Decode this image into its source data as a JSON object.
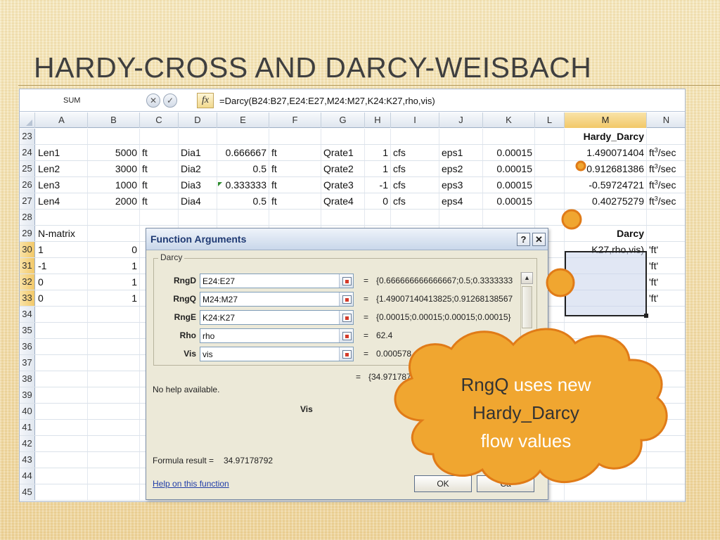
{
  "slide": {
    "title": "HARDY-CROSS AND DARCY-WEISBACH"
  },
  "formula_bar": {
    "name_box": "SUM",
    "cancel_icon": "✕",
    "enter_icon": "✓",
    "fx_label": "fx",
    "formula": "=Darcy(B24:B27,E24:E27,M24:M27,K24:K27,rho,vis)"
  },
  "columns": [
    "A",
    "B",
    "C",
    "D",
    "E",
    "F",
    "G",
    "H",
    "I",
    "J",
    "K",
    "L",
    "M",
    "N"
  ],
  "sheet": {
    "row_numbers": [
      "23",
      "24",
      "25",
      "26",
      "27",
      "28",
      "29",
      "30",
      "31",
      "32",
      "33",
      "34",
      "35",
      "36",
      "37",
      "38",
      "39",
      "40",
      "41",
      "42",
      "43",
      "44",
      "45"
    ],
    "cells": {
      "M23": "Hardy_Darcy",
      "A24": "Len1",
      "B24": "5000",
      "C24": "ft",
      "D24": "Dia1",
      "E24": "0.666667",
      "F24": "ft",
      "G24": "Qrate1",
      "H24": "1",
      "I24": "cfs",
      "J24": "eps1",
      "K24": "0.00015",
      "M24": "1.490071404",
      "A25": "Len2",
      "B25": "3000",
      "C25": "ft",
      "D25": "Dia2",
      "E25": "0.5",
      "F25": "ft",
      "G25": "Qrate2",
      "H25": "1",
      "I25": "cfs",
      "J25": "eps2",
      "K25": "0.00015",
      "M25": "0.912681386",
      "A26": "Len3",
      "B26": "1000",
      "C26": "ft",
      "D26": "Dia3",
      "E26": "0.333333",
      "F26": "ft",
      "G26": "Qrate3",
      "H26": "-1",
      "I26": "cfs",
      "J26": "eps3",
      "K26": "0.00015",
      "M26": "-0.59724721",
      "A27": "Len4",
      "B27": "2000",
      "C27": "ft",
      "D27": "Dia4",
      "E27": "0.5",
      "F27": "ft",
      "G27": "Qrate4",
      "H27": "0",
      "I27": "cfs",
      "J27": "eps4",
      "K27": "0.00015",
      "M27": "0.40275279",
      "A29": "N-matrix",
      "M29": "Darcy",
      "A30": "1",
      "B30": "0",
      "M30": "K27,rho,vis)",
      "N30": "'ft'",
      "A31": "-1",
      "B31": "1",
      "N31": "'ft'",
      "A32": "0",
      "B32": "1",
      "N32": "'ft'",
      "A33": "0",
      "B33": "1",
      "N33": "'ft'"
    },
    "unit_base": "ft",
    "unit_exp": "3",
    "unit_tail": "/sec"
  },
  "dialog": {
    "title": "Function Arguments",
    "help_button": "?",
    "close_button": "✕",
    "group_label": "Darcy",
    "args": [
      {
        "label": "RngD",
        "value": "E24:E27",
        "result": "{0.666666666666667;0.5;0.3333333"
      },
      {
        "label": "RngQ",
        "value": "M24:M27",
        "result": "{1.49007140413825;0.91268138567"
      },
      {
        "label": "RngE",
        "value": "K24:K27",
        "result": "{0.00015;0.00015;0.00015;0.00015}"
      },
      {
        "label": "Rho",
        "value": "rho",
        "result": "62.4"
      },
      {
        "label": "Vis",
        "value": "vis",
        "result": "0.000578"
      }
    ],
    "eq": "=",
    "total_result": "{34.97178791",
    "help_text": "No help available.",
    "arg_name": "Vis",
    "formula_result_label": "Formula result =",
    "formula_result_value": "34.97178792",
    "help_link": "Help on this function",
    "ok_label": "OK",
    "cancel_label": "Ca"
  },
  "callout": {
    "line1_dark": "RngQ",
    "line1_rest": " uses new",
    "line2": "Hardy_Darcy",
    "line3": "flow values",
    "fill_color": "#f0a630",
    "stroke_color": "#e07b18"
  }
}
